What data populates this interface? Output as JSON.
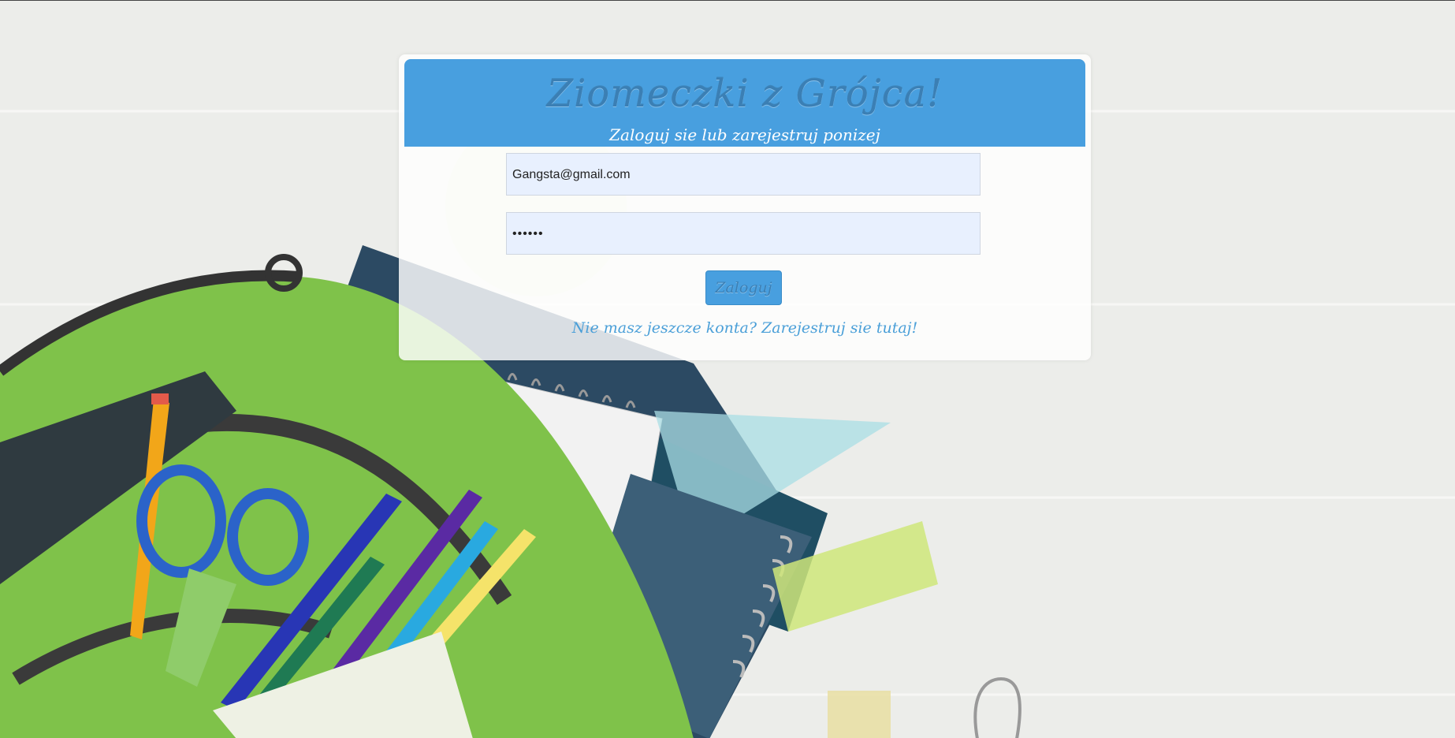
{
  "header": {
    "title": "Ziomeczki z Grójca!",
    "subtitle": "Zaloguj sie lub zarejestruj ponizej"
  },
  "form": {
    "email_value": "Gangsta@gmail.com",
    "password_value": "••••••",
    "login_label": "Zaloguj",
    "register_link": "Nie masz jeszcze konta? Zarejestruj sie tutaj!"
  },
  "colors": {
    "header_bg": "#489fdf",
    "input_bg": "#e8f0fe",
    "link": "#4a9fd8"
  }
}
